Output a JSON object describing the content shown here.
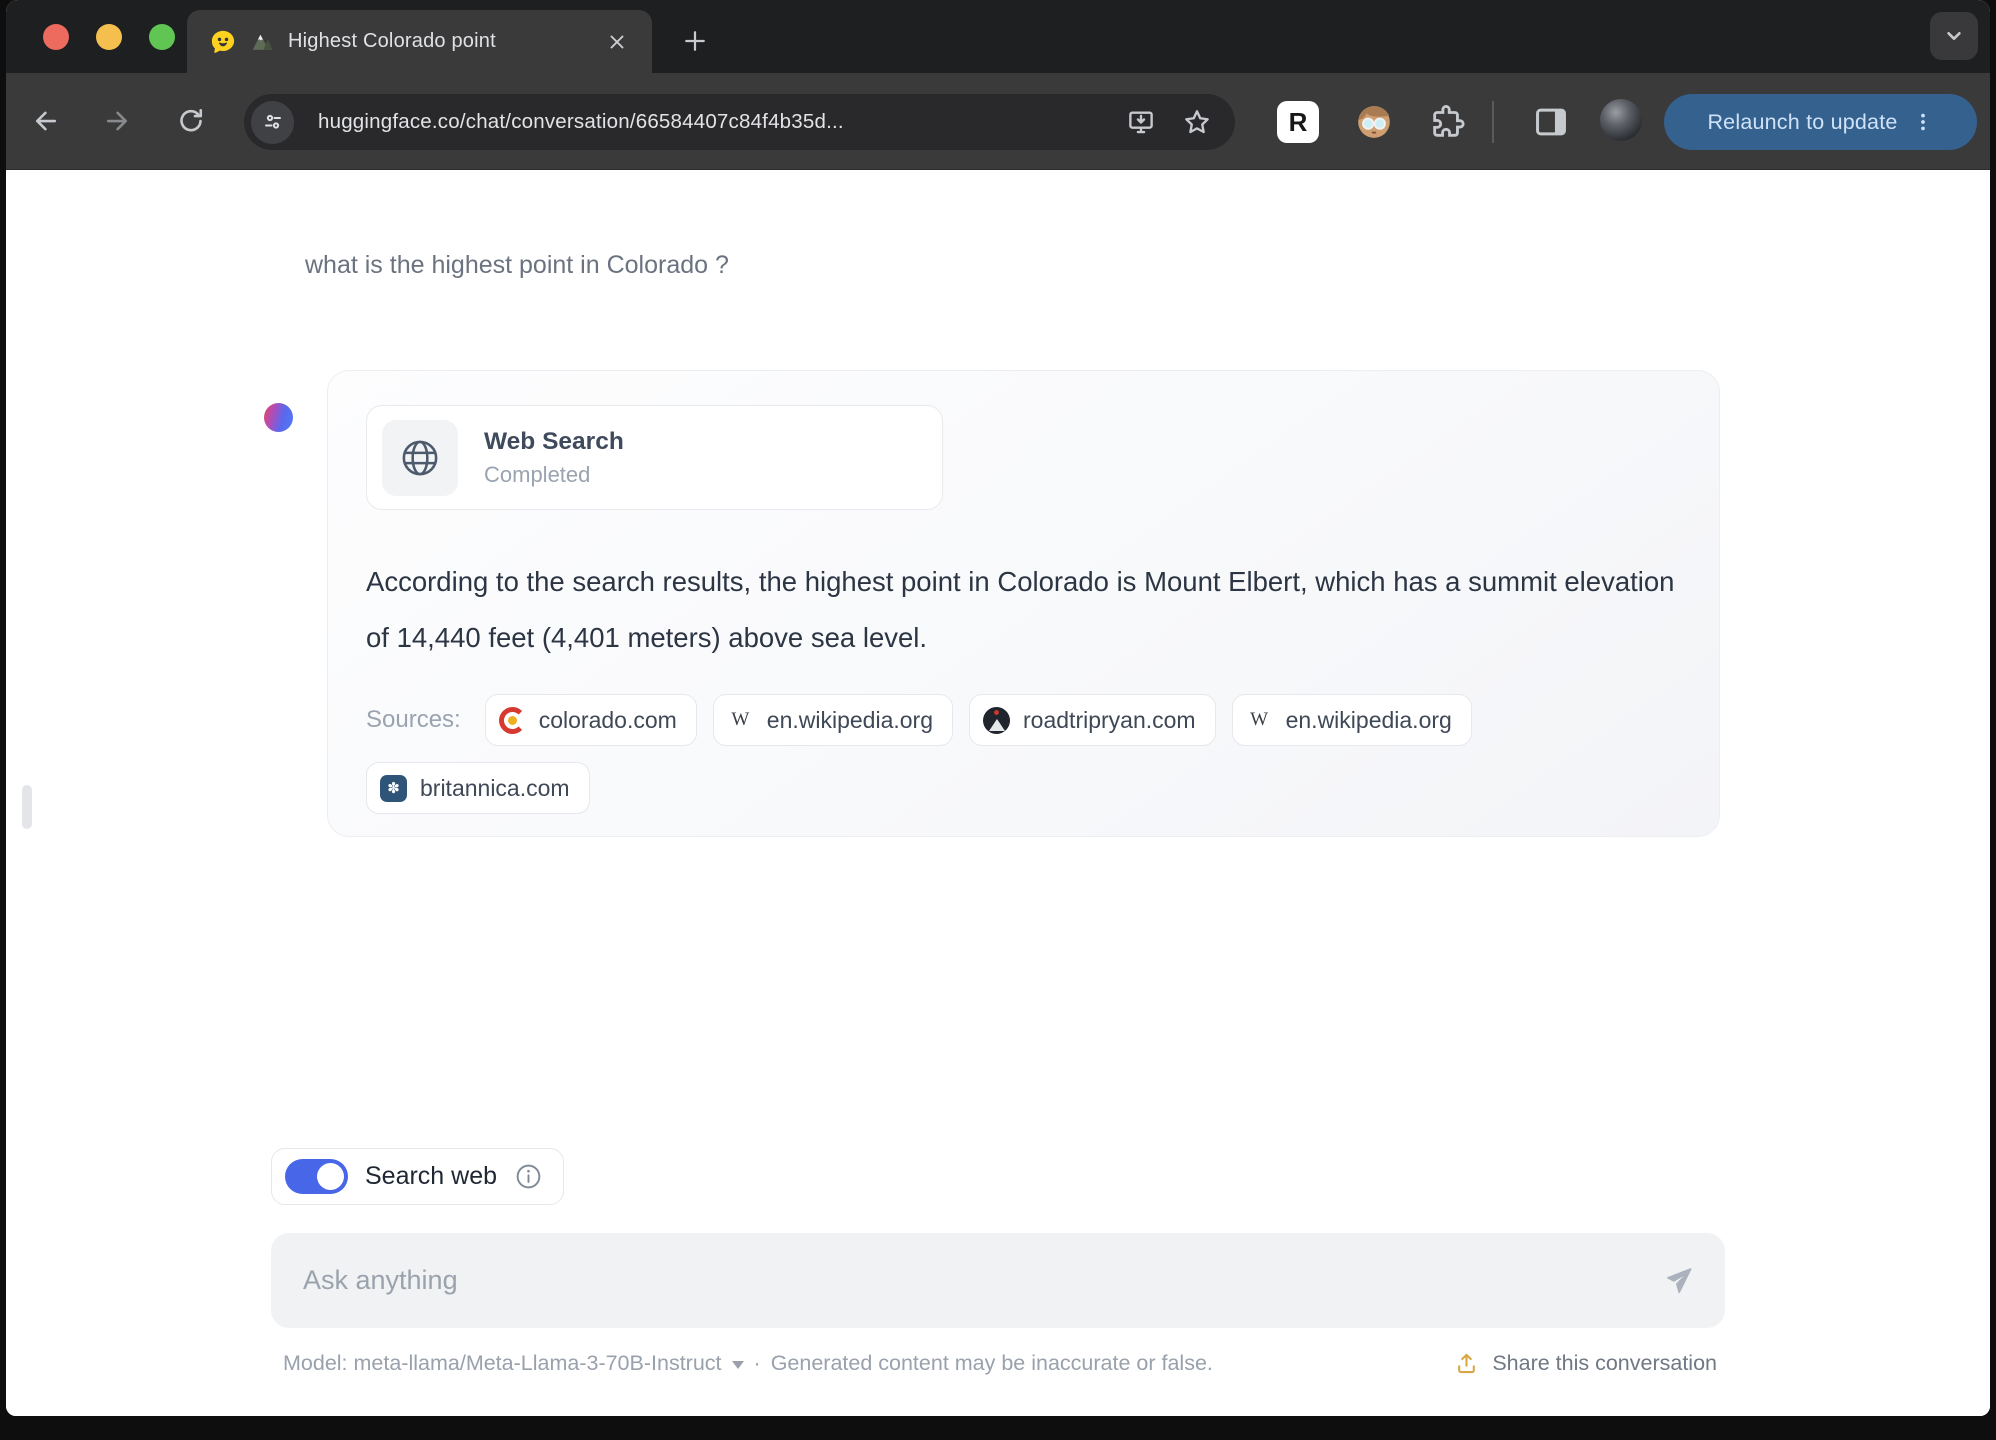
{
  "browser": {
    "tab_title": "Highest Colorado point",
    "url": "huggingface.co/chat/conversation/66584407c84f4b35d...",
    "relaunch_label": "Relaunch to update"
  },
  "chat": {
    "user_message": "what is the highest point in Colorado ?",
    "tool": {
      "title": "Web Search",
      "status": "Completed"
    },
    "response": "According to the search results, the highest point in Colorado is Mount Elbert, which has a summit elevation of 14,440 feet (4,401 meters) above sea level.",
    "sources_label": "Sources:",
    "sources": [
      {
        "domain": "colorado.com",
        "type": "colorado",
        "glyph": ""
      },
      {
        "domain": "en.wikipedia.org",
        "type": "wikipedia",
        "glyph": "W"
      },
      {
        "domain": "roadtripryan.com",
        "type": "roadtripryan",
        "glyph": ""
      },
      {
        "domain": "en.wikipedia.org",
        "type": "wikipedia",
        "glyph": "W"
      },
      {
        "domain": "britannica.com",
        "type": "britannica",
        "glyph": "✽"
      }
    ],
    "search_toggle_label": "Search web",
    "input_placeholder": "Ask anything",
    "footer": {
      "model_label": "Model: meta-llama/Meta-Llama-3-70B-Instruct",
      "separator": "·",
      "disclaimer": "Generated content may be inaccurate or false.",
      "share_label": "Share this conversation"
    }
  },
  "colors": {
    "accent_blue": "#4766e8",
    "relaunch_blue": "#35618e",
    "huggingchat_yellow": "#ffd21e"
  }
}
